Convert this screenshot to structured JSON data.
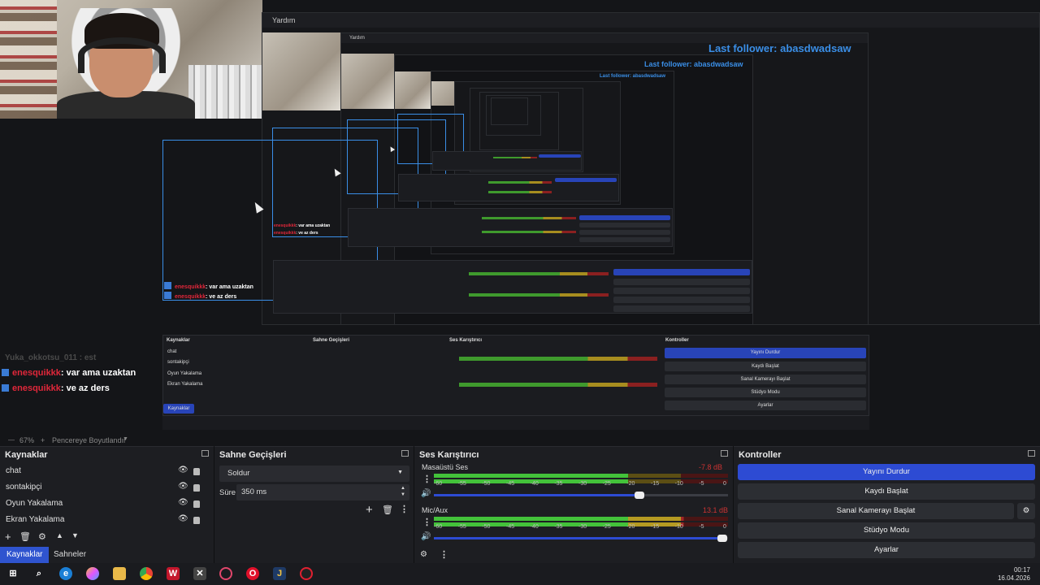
{
  "stream_overlay": {
    "last_follower": "Last follower: abasdwadsaw",
    "window_title": "Yardım",
    "chat": [
      {
        "user": "enesquikkk",
        "message": ": var ama uzaktan"
      },
      {
        "user": "enesquikkk",
        "message": ": ve az ders"
      }
    ],
    "faded_chat": "Yuka_okkotsu_011 : est"
  },
  "zoom_bar": {
    "zoom": "67%",
    "plus": "+",
    "resize_label": "Pencereye Boyutlandır"
  },
  "sources_dock": {
    "title": "Kaynaklar",
    "items": [
      {
        "label": "chat"
      },
      {
        "label": "sontakipçi"
      },
      {
        "label": "Oyun Yakalama"
      },
      {
        "label": "Ekran Yakalama"
      }
    ],
    "tabs": {
      "sources": "Kaynaklar",
      "scenes": "Sahneler"
    }
  },
  "transitions_dock": {
    "title": "Sahne Geçişleri",
    "transition": "Soldur",
    "duration_label": "Süre",
    "duration_value": "350 ms"
  },
  "mixer_dock": {
    "title": "Ses Karıştırıcı",
    "channels": [
      {
        "name": "Masaüstü Ses",
        "db": "-7.8 dB",
        "level": 0.66,
        "volume": 0.7
      },
      {
        "name": "Mic/Aux",
        "db": "13.1 dB",
        "level": 0.85,
        "volume": 0.98
      }
    ],
    "ticks": [
      "-60",
      "-55",
      "-50",
      "-45",
      "-40",
      "-35",
      "-30",
      "-25",
      "-20",
      "-15",
      "-10",
      "-5",
      "0"
    ]
  },
  "controls_dock": {
    "title": "Kontroller",
    "buttons": {
      "stop_stream": "Yayını Durdur",
      "start_record": "Kaydı Başlat",
      "virtual_cam": "Sanal Kamerayı Başlat",
      "studio_mode": "Stüdyo Modu",
      "settings": "Ayarlar"
    }
  },
  "taskbar": {
    "time": "00:17",
    "date": "16.04.2026"
  },
  "colors": {
    "accent": "#2d4bd3",
    "follower": "#3a8ee6",
    "chat_user": "#e0273a"
  }
}
